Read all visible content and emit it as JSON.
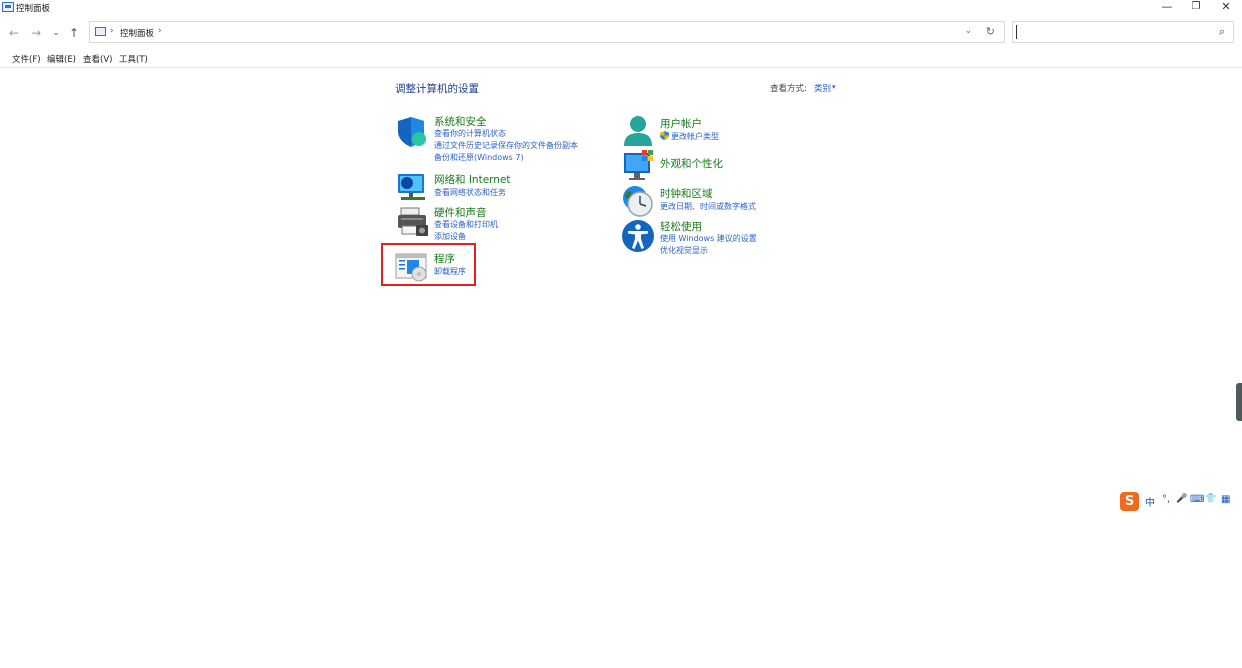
{
  "window": {
    "title": "控制面板",
    "minimize_glyph": "—",
    "maximize_glyph": "❐",
    "close_glyph": "✕"
  },
  "nav": {
    "back_glyph": "←",
    "forward_glyph": "→",
    "recent_glyph": "⌄",
    "up_glyph": "↑"
  },
  "address": {
    "separator": "›",
    "path": "控制面板",
    "trailing_separator": "›",
    "dropdown_glyph": "⌄",
    "refresh_glyph": "↻"
  },
  "search": {
    "value": "",
    "placeholder": "",
    "icon_glyph": "⌕"
  },
  "menu": {
    "file": "文件(F)",
    "edit": "编辑(E)",
    "view": "查看(V)",
    "tools": "工具(T)"
  },
  "content": {
    "title": "调整计算机的设置",
    "view_by_label": "查看方式:",
    "view_by_value": "类别",
    "view_by_caret": "▾"
  },
  "categories": {
    "system": {
      "title": "系统和安全",
      "links": [
        "查看你的计算机状态",
        "通过文件历史记录保存你的文件备份副本",
        "备份和还原(Windows 7)"
      ]
    },
    "network": {
      "title": "网络和 Internet",
      "links": [
        "查看网络状态和任务"
      ]
    },
    "hardware": {
      "title": "硬件和声音",
      "links": [
        "查看设备和打印机",
        "添加设备"
      ]
    },
    "programs": {
      "title": "程序",
      "links": [
        "卸载程序"
      ]
    },
    "users": {
      "title": "用户帐户",
      "links": [
        "更改帐户类型"
      ]
    },
    "appearance": {
      "title": "外观和个性化",
      "links": []
    },
    "clock": {
      "title": "时钟和区域",
      "links": [
        "更改日期、时间或数字格式"
      ]
    },
    "ease": {
      "title": "轻松使用",
      "links": [
        "使用 Windows 建议的设置",
        "优化视觉显示"
      ]
    }
  },
  "ime": {
    "logo": "S",
    "mode": "中",
    "punct": "°,",
    "mic": "🎤",
    "keyboard": "⌨",
    "skin": "👕",
    "menu": "▦"
  },
  "colors": {
    "category_title": "#17791b",
    "link": "#2a62c9",
    "highlight": "#e02020",
    "page_title": "#1e3d8f"
  }
}
